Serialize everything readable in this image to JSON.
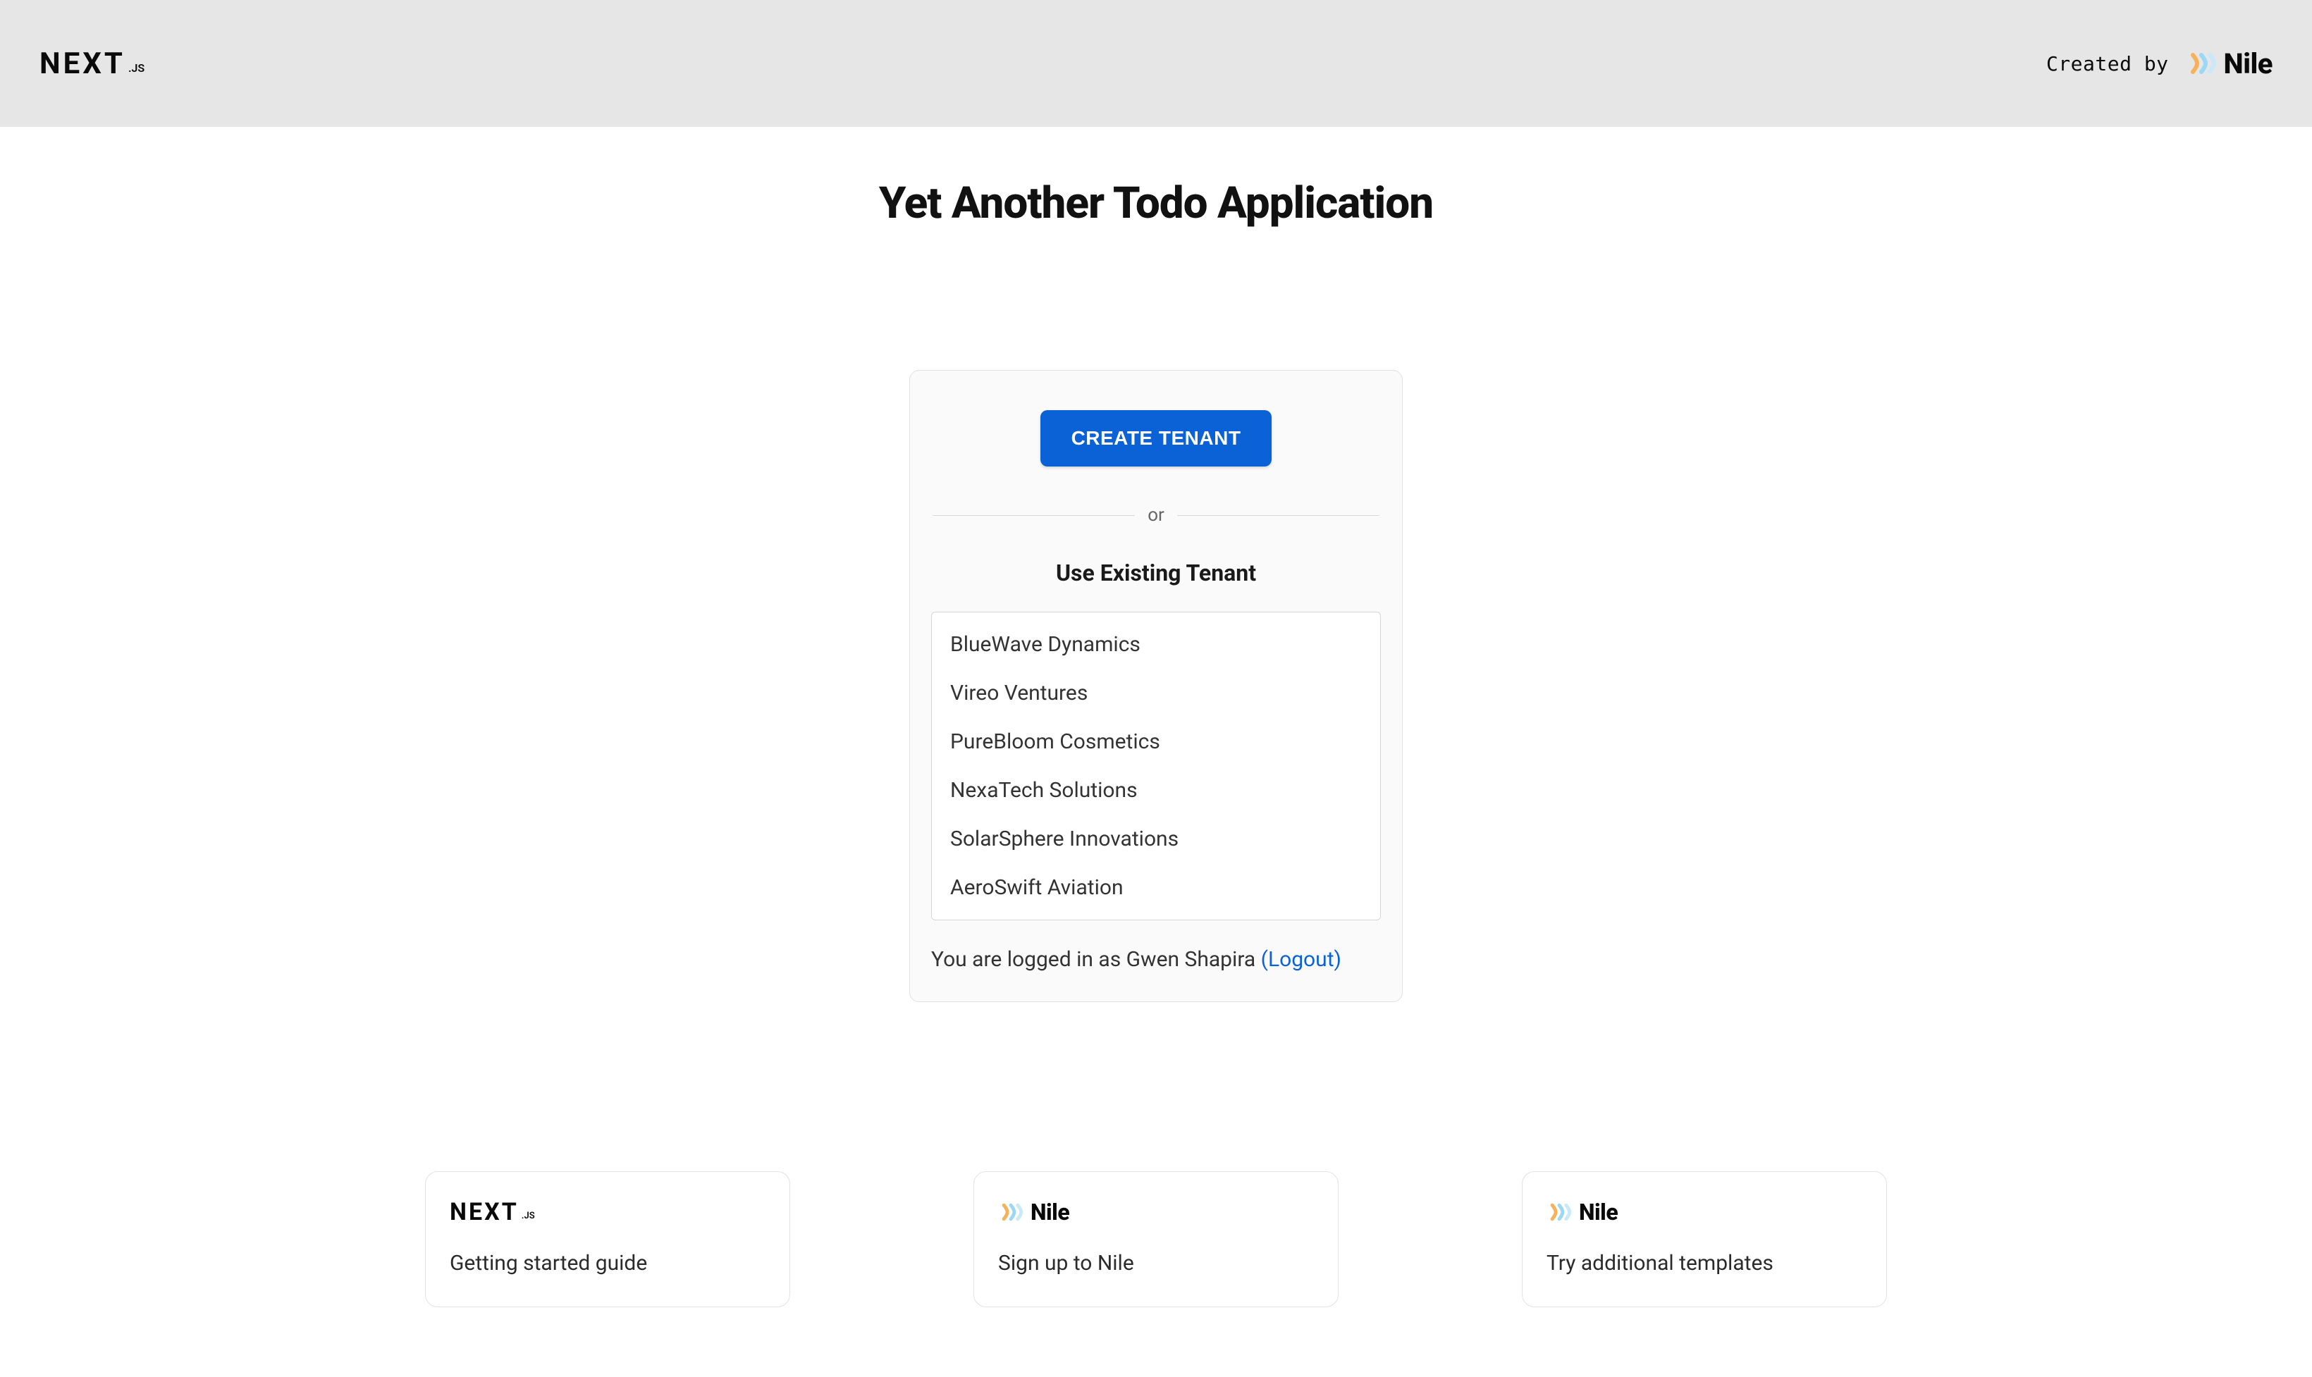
{
  "header": {
    "created_by_label": "Created by",
    "nile_brand": "Nile"
  },
  "page": {
    "title": "Yet Another Todo Application"
  },
  "card": {
    "create_button_label": "CREATE TENANT",
    "divider_label": "or",
    "existing_heading": "Use Existing Tenant",
    "tenants": [
      {
        "name": "BlueWave Dynamics"
      },
      {
        "name": "Vireo Ventures"
      },
      {
        "name": "PureBloom Cosmetics"
      },
      {
        "name": "NexaTech Solutions"
      },
      {
        "name": "SolarSphere Innovations"
      },
      {
        "name": "AeroSwift Aviation"
      }
    ],
    "logged_in_prefix": "You are logged in as ",
    "logged_in_user": "Gwen Shapira",
    "logout_label": "(Logout)"
  },
  "footer": {
    "cards": [
      {
        "logo": "nextjs",
        "caption": "Getting started guide"
      },
      {
        "logo": "nile",
        "caption": "Sign up to Nile"
      },
      {
        "logo": "nile",
        "caption": "Try additional templates"
      }
    ]
  },
  "logos": {
    "nextjs_word": "NEXT",
    "nextjs_suffix": ".JS",
    "nile_word": "Nile"
  }
}
